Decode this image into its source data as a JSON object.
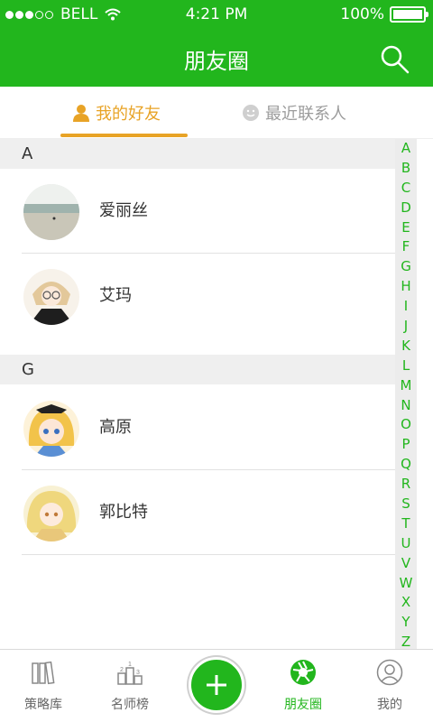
{
  "status": {
    "carrier": "BELL",
    "time": "4:21 PM",
    "battery": "100%"
  },
  "header": {
    "title": "朋友圈"
  },
  "tabs": [
    {
      "label": "我的好友",
      "active": true
    },
    {
      "label": "最近联系人",
      "active": false
    }
  ],
  "sections": [
    {
      "letter": "A",
      "contacts": [
        {
          "name": "爱丽丝"
        },
        {
          "name": "艾玛"
        }
      ]
    },
    {
      "letter": "G",
      "contacts": [
        {
          "name": "高原"
        },
        {
          "name": "郭比特"
        }
      ]
    }
  ],
  "index_letters": [
    "A",
    "B",
    "C",
    "D",
    "E",
    "F",
    "G",
    "H",
    "I",
    "J",
    "K",
    "L",
    "M",
    "N",
    "O",
    "P",
    "Q",
    "R",
    "S",
    "T",
    "U",
    "V",
    "W",
    "X",
    "Y",
    "Z"
  ],
  "bottom_nav": [
    {
      "label": "策略库",
      "icon": "books-icon"
    },
    {
      "label": "名师榜",
      "icon": "podium-icon"
    },
    {
      "label": "朋友圈",
      "icon": "aperture-icon",
      "active": true
    },
    {
      "label": "我的",
      "icon": "user-icon"
    }
  ],
  "colors": {
    "brand": "#22b61d",
    "accent": "#e8a326"
  }
}
